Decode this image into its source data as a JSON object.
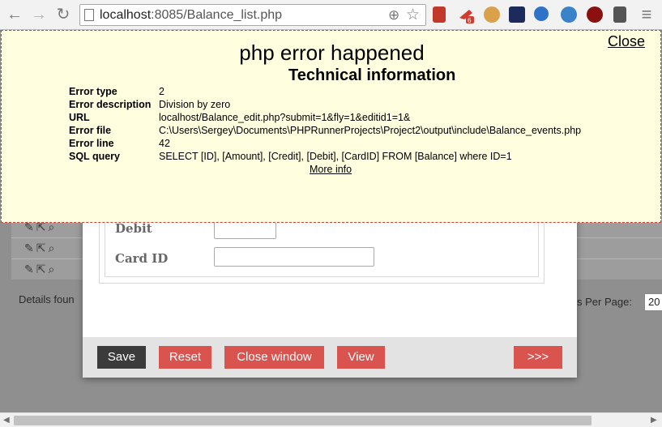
{
  "browser": {
    "back_icon": "←",
    "forward_icon": "→",
    "reload_icon": "↻",
    "url_host": "localhost",
    "url_path": ":8085/Balance_list.php",
    "zoom_icon": "⊕",
    "star_icon": "☆",
    "menu_icon": "≡",
    "badge_count": "6"
  },
  "list": {
    "row_icons": "✎⇱⌕",
    "details_found": "Details foun",
    "per_page_label": "s Per Page:",
    "per_page_value": "20"
  },
  "edit_form": {
    "fields": [
      {
        "label": "Debit",
        "value": ""
      },
      {
        "label": "Card ID",
        "value": ""
      }
    ],
    "buttons": {
      "save": "Save",
      "reset": "Reset",
      "close_window": "Close window",
      "view": "View",
      "next": ">>>"
    },
    "colors": {
      "save": "#3b3b3b",
      "action": "#d9534f"
    }
  },
  "error": {
    "title": "php error happened",
    "subtitle": "Technical information",
    "close_label": "Close",
    "rows": [
      {
        "key": "Error type",
        "value": "2"
      },
      {
        "key": "Error description",
        "value": "Division by zero"
      },
      {
        "key": "URL",
        "value": "localhost/Balance_edit.php?submit=1&fly=1&editid1=1&"
      },
      {
        "key": "Error file",
        "value": "C:\\Users\\Sergey\\Documents\\PHPRunnerProjects\\Project2\\output\\include\\Balance_events.php"
      },
      {
        "key": "Error line",
        "value": "42"
      },
      {
        "key": "SQL query",
        "value": "SELECT [ID], [Amount], [Credit], [Debit], [CardID] FROM [Balance] where ID=1"
      }
    ],
    "more_info": "More info",
    "background": "#ffffdf",
    "border": "#d23b3b"
  },
  "scrollbar": {
    "left_arrow": "◀",
    "right_arrow": "▶"
  }
}
